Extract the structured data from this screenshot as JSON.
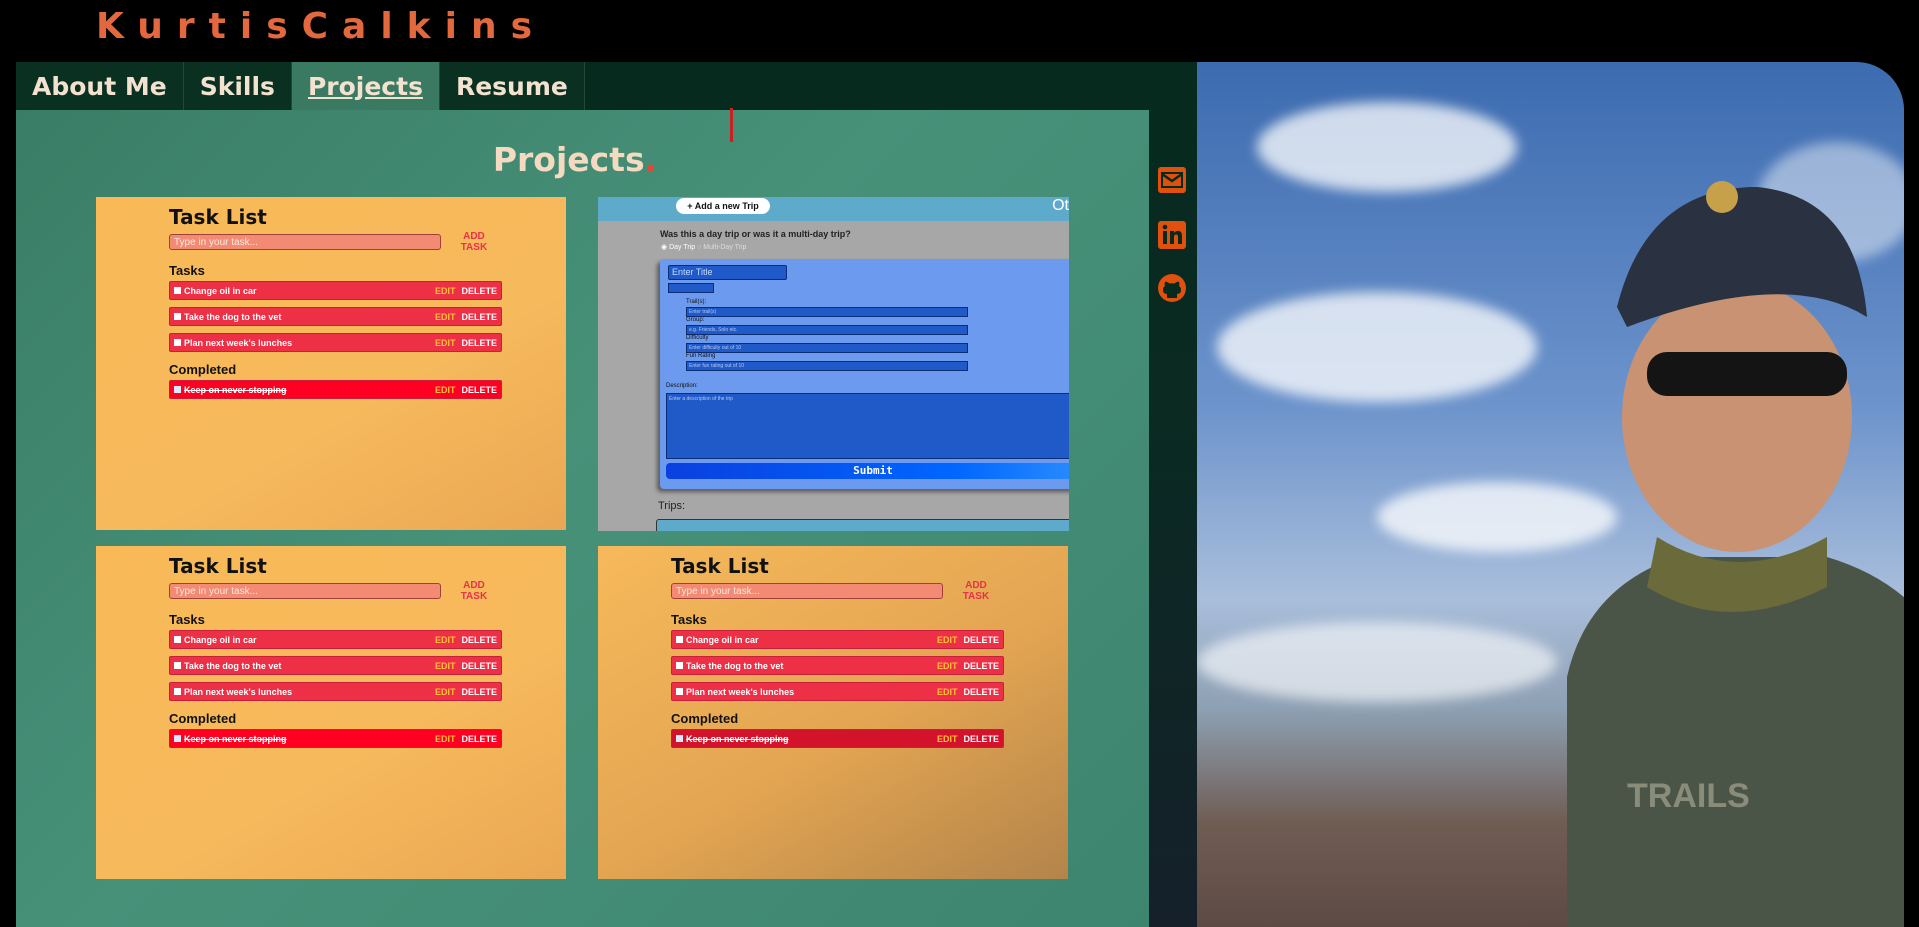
{
  "brand": "KurtisCalkins",
  "nav": {
    "tabs": [
      {
        "label": "About Me",
        "active": false
      },
      {
        "label": "Skills",
        "active": false
      },
      {
        "label": "Projects",
        "active": true
      },
      {
        "label": "Resume",
        "active": false
      }
    ]
  },
  "page": {
    "title": "Projects",
    "title_dot": "."
  },
  "task_list": {
    "title": "Task List",
    "input_placeholder": "Type in your task...",
    "add_label": "ADD TASK",
    "tasks_heading": "Tasks",
    "completed_heading": "Completed",
    "tasks": [
      "Change oil in car",
      "Take the dog to the vet",
      "Plan next week's lunches"
    ],
    "completed": [
      "Keep on never stopping"
    ],
    "edit_label": "EDIT",
    "delete_label": "DELETE"
  },
  "trip": {
    "add_button": "+ Add a new Trip",
    "top_right_text": "Ot",
    "question": "Was this a day trip or was it a multi-day trip?",
    "option_day": "Day Trip",
    "option_multi": "Multi-Day Trip",
    "title_placeholder": "Enter Title",
    "fields": [
      {
        "label": "Trail(s):",
        "placeholder": "Enter trail(s)"
      },
      {
        "label": "Group:",
        "placeholder": "e.g. Friends, Solo etc."
      },
      {
        "label": "Difficulty",
        "placeholder": "Enter difficulty out of 10"
      },
      {
        "label": "Fun Rating",
        "placeholder": "Enter fun rating out of 10"
      }
    ],
    "description_label": "Description:",
    "description_placeholder": "Enter a description of the trip",
    "submit_label": "Submit",
    "trips_label": "Trips:"
  },
  "social": [
    "mail-icon",
    "linkedin-icon",
    "github-icon"
  ],
  "colors": {
    "accent": "#e4683d",
    "panel": "#479179",
    "card": "#f9b957",
    "task": "#ee3047",
    "social": "#e0500f"
  }
}
